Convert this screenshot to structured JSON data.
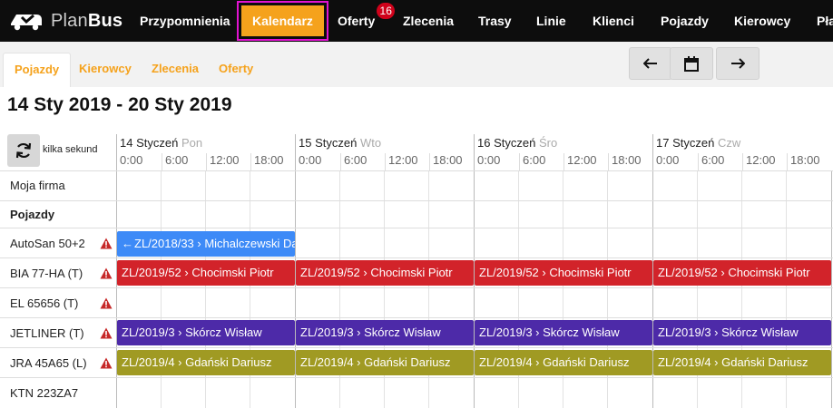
{
  "app": {
    "logo_plan": "Plan",
    "logo_bus": "Bus"
  },
  "nav": {
    "items": [
      {
        "label": "Przypomnienia"
      },
      {
        "label": "Kalendarz",
        "active": true
      },
      {
        "label": "Oferty",
        "badge": "16"
      },
      {
        "label": "Zlecenia"
      },
      {
        "label": "Trasy"
      },
      {
        "label": "Linie"
      },
      {
        "label": "Klienci"
      },
      {
        "label": "Pojazdy"
      },
      {
        "label": "Kierowcy"
      },
      {
        "label": "Pła"
      }
    ]
  },
  "subtabs": [
    {
      "label": "Pojazdy",
      "active": true
    },
    {
      "label": "Kierowcy"
    },
    {
      "label": "Zlecenia"
    },
    {
      "label": "Oferty"
    }
  ],
  "week_title": "14 Sty 2019 - 20 Sty 2019",
  "refresh_label": "kilka sekund",
  "days": [
    {
      "date": "14 Styczeń",
      "weekday": "Pon"
    },
    {
      "date": "15 Styczeń",
      "weekday": "Wto"
    },
    {
      "date": "16 Styczeń",
      "weekday": "Śro"
    },
    {
      "date": "17 Styczeń",
      "weekday": "Czw"
    }
  ],
  "hours": [
    "0:00",
    "6:00",
    "12:00",
    "18:00"
  ],
  "rows": [
    {
      "label": "Moja firma"
    },
    {
      "label": "Pojazdy",
      "section": true
    },
    {
      "label": "AutoSan 50+2",
      "warning": true
    },
    {
      "label": "BIA 77-HA (T)",
      "warning": true
    },
    {
      "label": "EL 65656 (T)",
      "warning": true
    },
    {
      "label": "JETLINER (T)",
      "warning": true
    },
    {
      "label": "JRA 45A65 (L)",
      "warning": true
    },
    {
      "label": "KTN 223ZA7"
    }
  ],
  "bars": {
    "autosan": {
      "text": "ZL/2018/33 › Michalczewski Da",
      "color": "#3d8af7",
      "continues_left": true
    },
    "bia": {
      "text": "ZL/2019/52 › Chocimski Piotr",
      "color": "#d2232a"
    },
    "jetliner": {
      "text": "ZL/2019/3 › Skórcz Wisław",
      "color": "#4d2aa8"
    },
    "jra": {
      "text": "ZL/2019/4 › Gdański Dariusz",
      "color": "#a09a23"
    }
  },
  "icons": {
    "warning": "warning-triangle-icon",
    "prev": "arrow-left-icon",
    "next": "arrow-right-icon",
    "calendar": "calendar-icon",
    "refresh": "refresh-icon"
  },
  "colors": {
    "accent": "#f5a21c",
    "highlight": "#e213d1",
    "warning": "#c62828"
  }
}
